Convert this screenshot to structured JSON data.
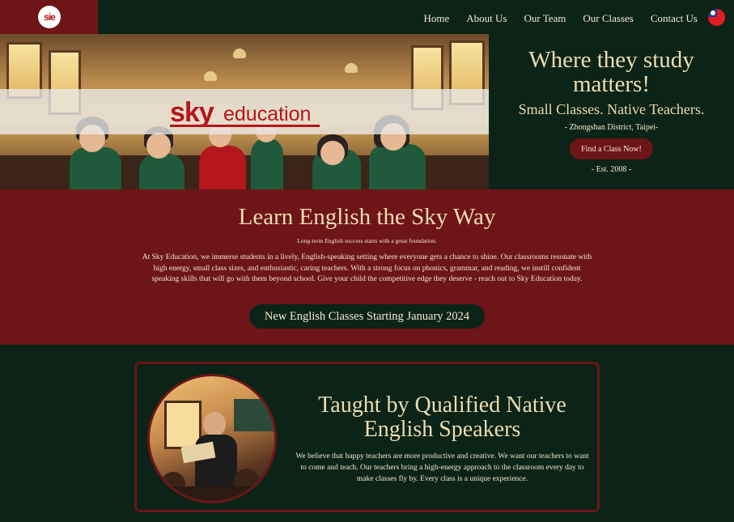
{
  "nav": {
    "logo_text": "sie",
    "links": [
      "Home",
      "About Us",
      "Our Team",
      "Our Classes",
      "Contact Us"
    ],
    "flag_icon": "taiwan-flag-icon"
  },
  "hero": {
    "brand_sky": "sky",
    "brand_education": "education",
    "title": "Where they study matters!",
    "subtitle": "Small Classes. Native Teachers.",
    "location": "- Zhongshan District, Taipei-",
    "cta_label": "Find a Class Now!",
    "established": "- Est. 2008 -"
  },
  "learn": {
    "title": "Learn English the Sky Way",
    "tagline": "Long-term English success starts with a great foundation.",
    "body": "At Sky Education, we immerse students in a lively, English-speaking setting where everyone gets a chance to shine. Our classrooms resonate with high energy, small class sizes, and enthusiastic, caring teachers. With a strong focus on phonics, grammar, and reading, we instill confident speaking skills that will go with them beyond school. Give your child the competitive edge they deserve - reach out to Sky Education today.",
    "announcement": "New English Classes Starting January 2024"
  },
  "teachers": {
    "title": "Taught by Qualified Native English Speakers",
    "body": "We believe that happy teachers are more productive and creative. We want our teachers to want to come and teach. Our teachers bring a high-energy approach to the classroom every day to make classes fly by. Every class is a unique experience."
  },
  "colors": {
    "dark_green": "#0b2417",
    "maroon": "#6d1517",
    "cream": "#efdcb0",
    "brand_red": "#b3161b"
  }
}
